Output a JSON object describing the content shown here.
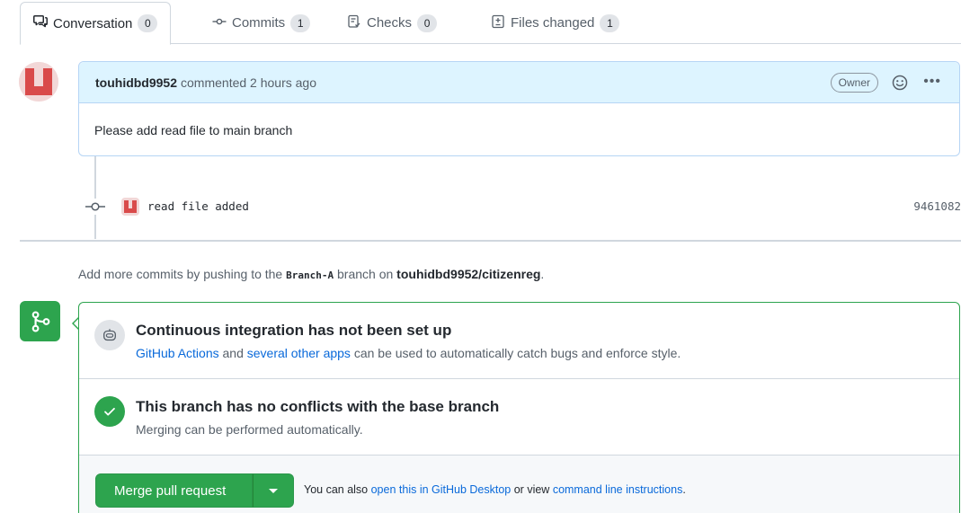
{
  "tabs": [
    {
      "label": "Conversation",
      "count": "0",
      "icon": "comment-discussion-icon"
    },
    {
      "label": "Commits",
      "count": "1",
      "icon": "git-commit-icon"
    },
    {
      "label": "Checks",
      "count": "0",
      "icon": "checklist-icon"
    },
    {
      "label": "Files changed",
      "count": "1",
      "icon": "file-diff-icon"
    }
  ],
  "comment": {
    "author": "touhidbd9952",
    "action": "commented 2 hours ago",
    "role_badge": "Owner",
    "body": "Please add read file to main branch"
  },
  "commit": {
    "message": "read file added",
    "sha": "9461082"
  },
  "push_hint": {
    "prefix": "Add more commits by pushing to the",
    "branch": "Branch-A",
    "middle": "branch on",
    "repo": "touhidbd9952/citizenreg",
    "suffix": "."
  },
  "ci": {
    "title": "Continuous integration has not been set up",
    "link1": "GitHub Actions",
    "and": "and",
    "link2": "several other apps",
    "rest": "can be used to automatically catch bugs and enforce style."
  },
  "conflicts": {
    "title": "This branch has no conflicts with the base branch",
    "subtitle": "Merging can be performed automatically."
  },
  "merge": {
    "button_label": "Merge pull request",
    "also_prefix": "You can also",
    "link_desktop": "open this in GitHub Desktop",
    "or_view": "or view",
    "link_cli": "command line instructions",
    "suffix": "."
  },
  "colors": {
    "accent_green": "#2da44e",
    "link_blue": "#0969da",
    "header_blue": "#ddf4ff"
  }
}
